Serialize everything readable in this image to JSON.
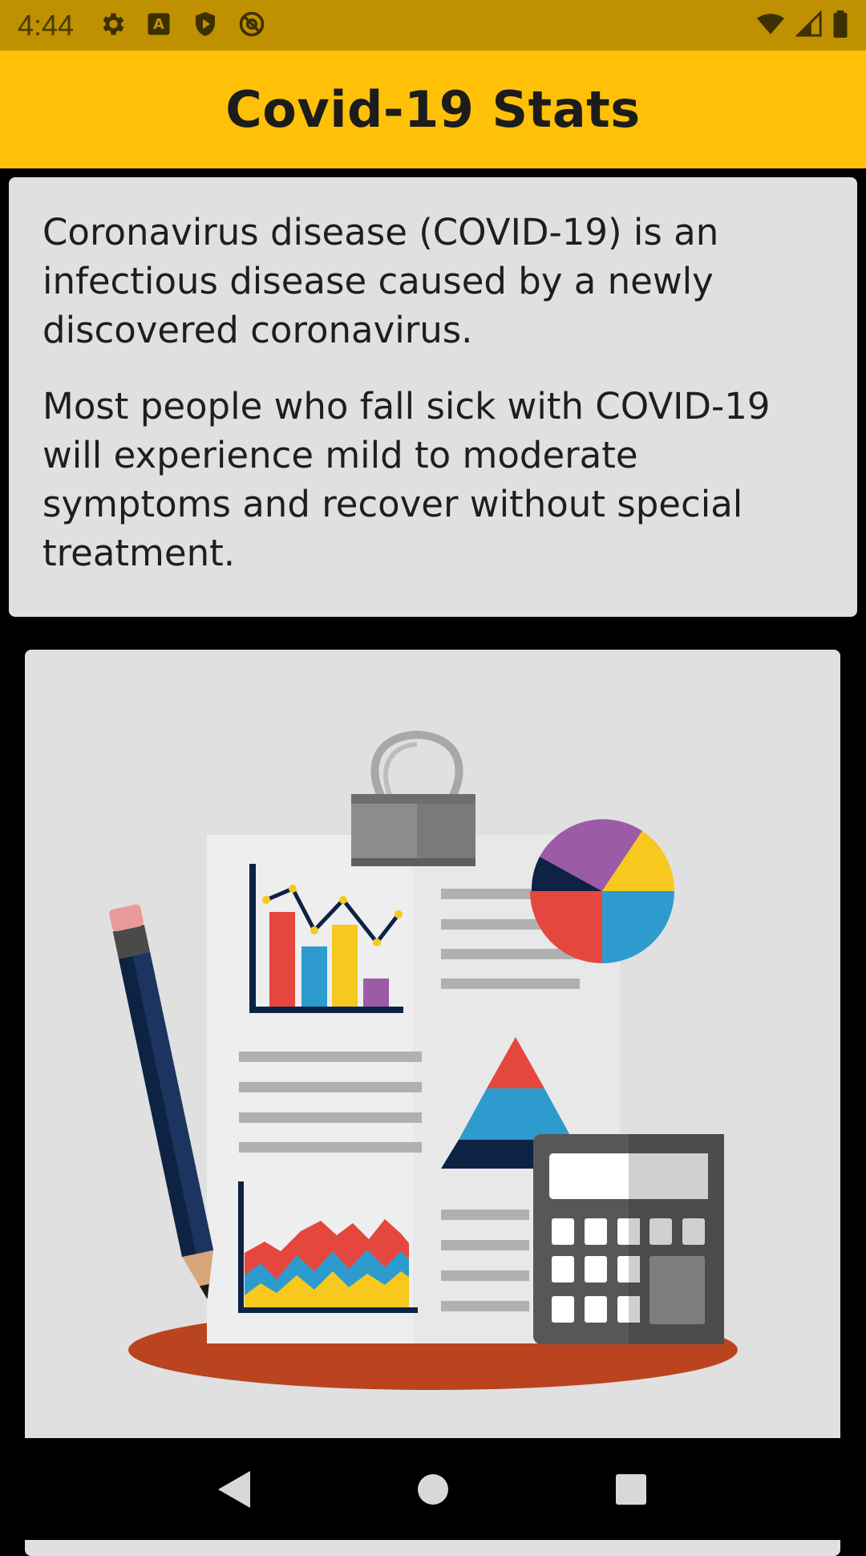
{
  "status_bar": {
    "time": "4:44",
    "left_icons": [
      "settings-icon",
      "keyboard-a-icon",
      "play-protect-icon",
      "at-sign-icon"
    ],
    "right_icons": [
      "wifi-icon",
      "cellular-signal-icon",
      "battery-icon"
    ],
    "background": "#BF9000"
  },
  "app_bar": {
    "title": "Covid-19 Stats",
    "background": "#FFC107"
  },
  "info_card": {
    "paragraphs": [
      "Coronavirus disease (COVID-19) is an infectious disease caused by a newly discovered coronavirus.",
      "Most people who fall sick with COVID-19 will experience mild to moderate symptoms and recover without special treatment."
    ],
    "background": "#E0E0E0"
  },
  "illustration": {
    "subject": "statistics-clipboard-illustration",
    "elements": [
      "binder-clip-icon",
      "bar-chart-icon",
      "pie-chart-icon",
      "pyramid-chart-icon",
      "area-chart-icon",
      "pencil-icon",
      "calculator-icon"
    ]
  },
  "nav_bar": {
    "buttons": [
      "back-icon",
      "home-icon",
      "recents-icon"
    ]
  }
}
